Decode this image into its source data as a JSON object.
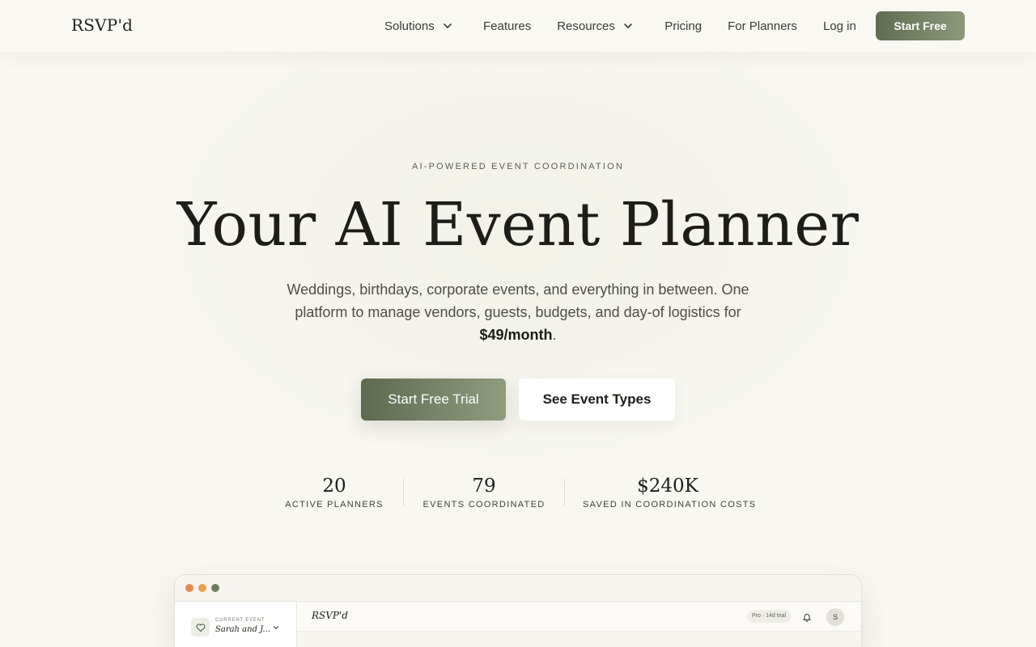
{
  "nav": {
    "logo": "RSVP'd",
    "items": [
      {
        "label": "Solutions",
        "dropdown": true
      },
      {
        "label": "Features",
        "dropdown": false
      },
      {
        "label": "Resources",
        "dropdown": true
      },
      {
        "label": "Pricing",
        "dropdown": false
      },
      {
        "label": "For Planners",
        "dropdown": false
      },
      {
        "label": "Log in",
        "dropdown": false
      }
    ],
    "cta": "Start Free"
  },
  "hero": {
    "eyebrow": "AI-POWERED EVENT COORDINATION",
    "title": "Your AI Event Planner",
    "subtitle_before": "Weddings, birthdays, corporate events, and everything in between. One platform to manage vendors, guests, budgets, and day-of logistics for ",
    "subtitle_price": "$49/month",
    "subtitle_after": ".",
    "primary_button": "Start Free Trial",
    "secondary_button": "See Event Types"
  },
  "stats": [
    {
      "value": "20",
      "label": "ACTIVE PLANNERS"
    },
    {
      "value": "79",
      "label": "EVENTS COORDINATED"
    },
    {
      "value": "$240K",
      "label": "SAVED IN COORDINATION COSTS"
    }
  ],
  "preview": {
    "traffic_colors": [
      "#e98a53",
      "#e9a04f",
      "#6f7d5e"
    ],
    "sidebar": {
      "caption": "CURRENT EVENT",
      "event_name": "Sarah and J..."
    },
    "topbar": {
      "logo": "RSVP'd",
      "badge": "Pro · 14d trial",
      "avatar_initial": "S"
    }
  },
  "colors": {
    "accent_start": "#5e6a4e",
    "accent_end": "#8f9c7e",
    "background": "#f8f7f2"
  }
}
